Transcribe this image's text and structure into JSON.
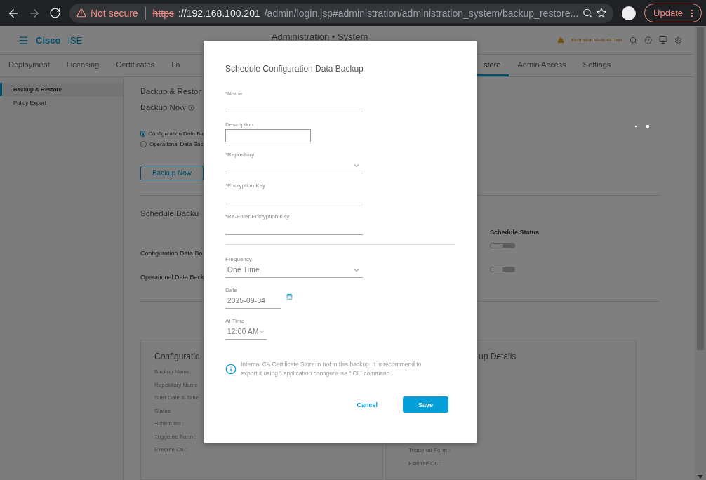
{
  "browser": {
    "security": "Not secure",
    "scheme": "https",
    "host": "://192.168.100.201",
    "path": "/admin/login.jsp#administration/administration_system/backup_restore...",
    "update_button": "Update"
  },
  "header": {
    "brand": "Cisco",
    "product": "ISE",
    "page_title": "Administration • System",
    "notice": "Evaluation Mode 49 Days"
  },
  "tabs": [
    {
      "label": "Deployment",
      "selected": false
    },
    {
      "label": "Licensing",
      "selected": false
    },
    {
      "label": "Certificates",
      "selected": false
    },
    {
      "label": "Lo",
      "selected": false
    },
    {
      "label": "store",
      "selected": true
    },
    {
      "label": "Admin Access",
      "selected": false
    },
    {
      "label": "Settings",
      "selected": false
    }
  ],
  "sidebar": {
    "items": [
      {
        "label": "Backup & Restore",
        "selected": true
      },
      {
        "label": "Policy Export",
        "selected": false
      }
    ]
  },
  "main": {
    "heading": "Backup & Restor",
    "backup_now": {
      "title": "Backup Now",
      "options": [
        {
          "label": "Configuration Data Ba",
          "selected": true
        },
        {
          "label": "Operational Data Bac",
          "selected": false
        }
      ],
      "button": "Backup Now"
    },
    "schedule": {
      "title": "Schedule Backu",
      "status_heading": "Schedule Status",
      "rows": [
        {
          "label": "Configuration Data Ba",
          "on": false
        },
        {
          "label": "Operational Data Back",
          "on": false
        }
      ]
    },
    "cards": [
      {
        "title": "Configuratio",
        "rows": [
          "Backup Name:",
          "Repository Name",
          "Start Date & Time",
          "Status",
          "Scheduled :",
          "Triggered Form :",
          "Execute On :"
        ]
      },
      {
        "title": "up Details",
        "rows": [
          "Triggered Form :",
          "Execute On :"
        ]
      }
    ]
  },
  "modal": {
    "title": "Schedule Configuration Data Backup",
    "fields": [
      {
        "kind": "text",
        "label": "*Name"
      },
      {
        "kind": "textarea",
        "label": "Description"
      },
      {
        "kind": "select",
        "label": "*Repository"
      },
      {
        "kind": "text",
        "label": "*Encryption Key"
      },
      {
        "kind": "text",
        "label": "*Re-Enter Encryption Key"
      },
      {
        "kind": "divider"
      },
      {
        "kind": "select",
        "label": "Frequency",
        "value": "One Time"
      },
      {
        "kind": "date",
        "label": "Date",
        "value": "2025-09-04"
      },
      {
        "kind": "time",
        "label": "At Time",
        "value": "12:00 AM"
      }
    ],
    "note": "Internal CA Certificate Store in not in this backup. It is recommend to export it using \" application configure ise \" CLI command",
    "cancel": "Cancel",
    "save": "Save"
  }
}
